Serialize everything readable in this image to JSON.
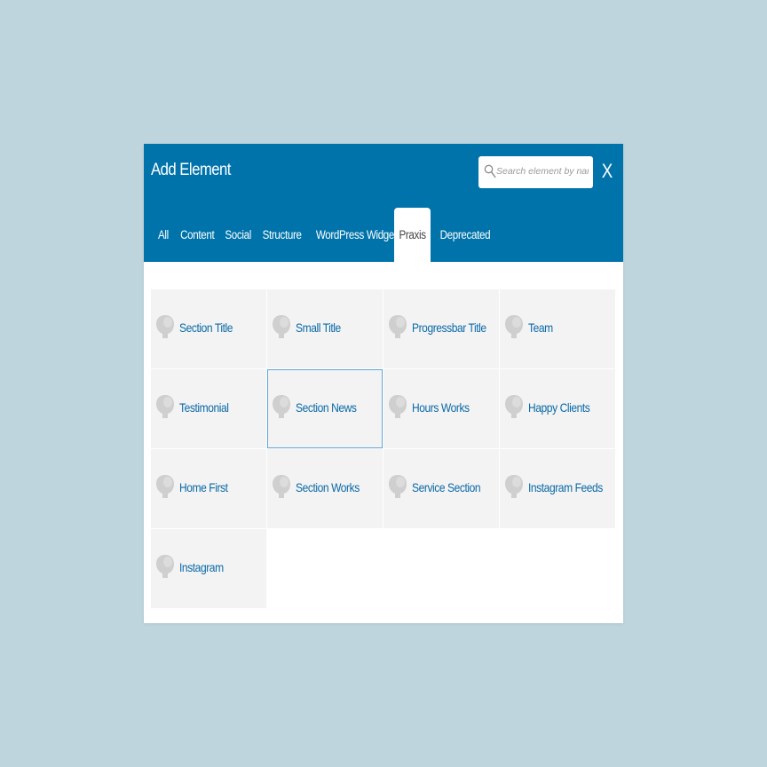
{
  "dialog": {
    "title": "Add Element",
    "close_label": "X"
  },
  "search": {
    "placeholder": "Search element by name",
    "value": ""
  },
  "tabs": [
    {
      "label": "All",
      "active": false
    },
    {
      "label": "Content",
      "active": false
    },
    {
      "label": "Social",
      "active": false
    },
    {
      "label": "Structure",
      "active": false
    },
    {
      "label": "WordPress Widgets",
      "active": false
    },
    {
      "label": "Praxis",
      "active": true
    },
    {
      "label": "Deprecated",
      "active": false
    }
  ],
  "elements": [
    {
      "label": "Section Title",
      "icon": "element-placeholder-icon"
    },
    {
      "label": "Small Title",
      "icon": "element-placeholder-icon"
    },
    {
      "label": "Progressbar Title",
      "icon": "element-placeholder-icon"
    },
    {
      "label": "Team",
      "icon": "element-placeholder-icon"
    },
    {
      "label": "Testimonial",
      "icon": "element-placeholder-icon"
    },
    {
      "label": "Section News",
      "icon": "element-placeholder-icon",
      "highlighted": true
    },
    {
      "label": "Hours Works",
      "icon": "element-placeholder-icon"
    },
    {
      "label": "Happy Clients",
      "icon": "element-placeholder-icon"
    },
    {
      "label": "Home First",
      "icon": "element-placeholder-icon"
    },
    {
      "label": "Section Works",
      "icon": "element-placeholder-icon"
    },
    {
      "label": "Service Section",
      "icon": "element-placeholder-icon"
    },
    {
      "label": "Instagram Feeds",
      "icon": "element-placeholder-icon"
    },
    {
      "label": "Instagram",
      "icon": "element-placeholder-icon"
    }
  ],
  "colors": {
    "page_background": "#bed5dd",
    "header": "#0073aa",
    "cell_background": "#f3f3f3",
    "label_link": "#0b6aa8",
    "highlight_border": "#5ea6d6"
  }
}
